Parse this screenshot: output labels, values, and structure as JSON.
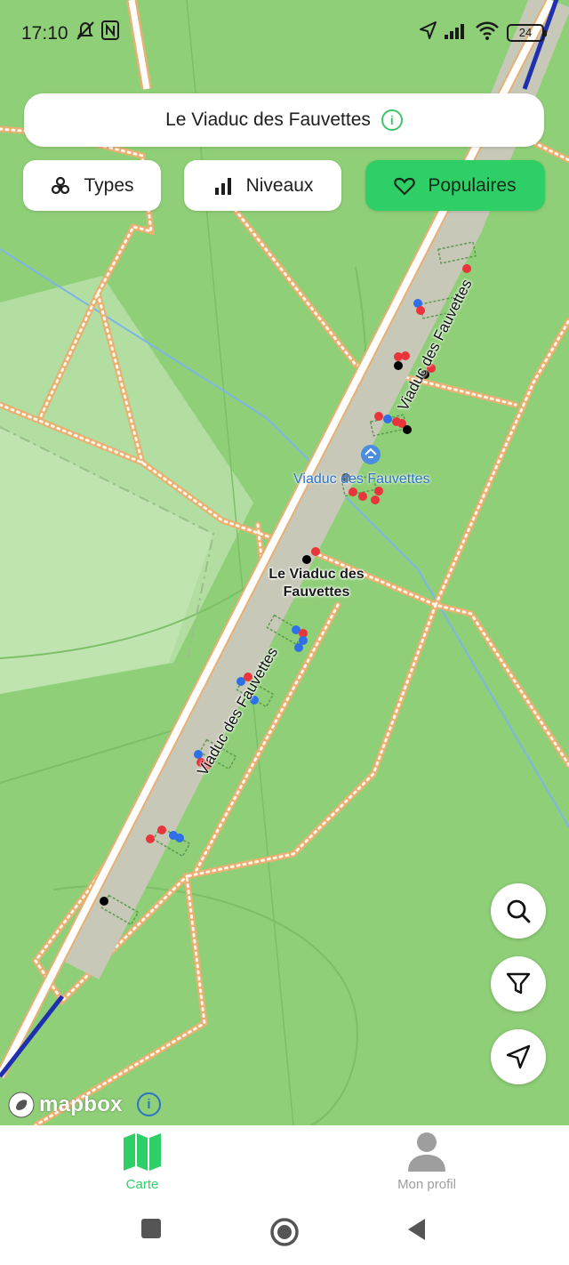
{
  "status_bar": {
    "time": "17:10",
    "battery": "24",
    "icons": [
      "bell-off-icon",
      "nfc-icon",
      "location-arrow-icon",
      "signal-icon",
      "wifi-icon",
      "battery-icon"
    ]
  },
  "title_bar": {
    "title": "Le Viaduc des Fauvettes",
    "info_icon": "info-circle-icon",
    "info_glyph": "i"
  },
  "filters": [
    {
      "label": "Types",
      "icon": "biohazard-icon",
      "active": false
    },
    {
      "label": "Niveaux",
      "icon": "bar-chart-icon",
      "active": false
    },
    {
      "label": "Populaires",
      "icon": "heart-icon",
      "active": true
    }
  ],
  "map": {
    "poi_label": "Viaduc des Fauvettes",
    "place_label_line1": "Le Viaduc des",
    "place_label_line2": "Fauvettes",
    "road_label_1": "Viaduc des Fauvettes",
    "road_label_2": "Viaduc des Fauvettes",
    "attribution": "mapbox",
    "colors": {
      "background": "#8fcf78",
      "path": "#f3c98b",
      "accent": "#2fcf68",
      "poi": "#2d73c4"
    }
  },
  "fabs": [
    {
      "name": "search-button",
      "icon": "search-icon"
    },
    {
      "name": "filter-button",
      "icon": "filter-icon"
    },
    {
      "name": "locate-button",
      "icon": "navigation-icon"
    }
  ],
  "bottom_nav": {
    "items": [
      {
        "label": "Carte",
        "icon": "map-icon",
        "active": true,
        "color": "#2fcf68"
      },
      {
        "label": "Mon profil",
        "icon": "person-icon",
        "active": false,
        "color": "#9e9e9e"
      }
    ]
  },
  "system_nav": [
    "recents-square-icon",
    "home-circle-icon",
    "back-triangle-icon"
  ]
}
